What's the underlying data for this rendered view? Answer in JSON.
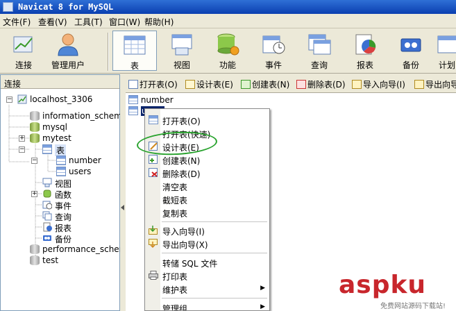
{
  "window": {
    "title": "Navicat 8 for MySQL"
  },
  "menu": [
    "文件(F)",
    "查看(V)",
    "工具(T)",
    "窗口(W)",
    "帮助(H)"
  ],
  "toolbar": [
    {
      "label": "连接",
      "icon": "connect-icon"
    },
    {
      "label": "管理用户",
      "icon": "user-icon"
    },
    {
      "label": "表",
      "icon": "table-icon",
      "selected": true
    },
    {
      "label": "视图",
      "icon": "view-icon"
    },
    {
      "label": "功能",
      "icon": "function-icon"
    },
    {
      "label": "事件",
      "icon": "event-icon"
    },
    {
      "label": "查询",
      "icon": "query-icon"
    },
    {
      "label": "报表",
      "icon": "report-icon"
    },
    {
      "label": "备份",
      "icon": "backup-icon"
    },
    {
      "label": "计划",
      "icon": "schedule-icon"
    }
  ],
  "left": {
    "header": "连接",
    "tree": [
      {
        "label": "localhost_3306"
      },
      {
        "label": "information_schema"
      },
      {
        "label": "mysql"
      },
      {
        "label": "mytest"
      },
      {
        "label": "表"
      },
      {
        "label": "number"
      },
      {
        "label": "users"
      },
      {
        "label": "视图"
      },
      {
        "label": "函数"
      },
      {
        "label": "事件"
      },
      {
        "label": "查询"
      },
      {
        "label": "报表"
      },
      {
        "label": "备份"
      },
      {
        "label": "performance_schema"
      },
      {
        "label": "test"
      }
    ]
  },
  "actions": [
    "打开表(O)",
    "设计表(E)",
    "创建表(N)",
    "删除表(D)",
    "导入向导(I)",
    "导出向导(X)"
  ],
  "items": [
    "number",
    "users"
  ],
  "context_menu": {
    "items": [
      "打开表(O)",
      "打开表(快速)",
      "设计表(E)",
      "创建表(N)",
      "删除表(D)",
      "清空表",
      "截短表",
      "复制表",
      "导入向导(I)",
      "导出向导(X)",
      "转储 SQL 文件",
      "打印表",
      "维护表",
      "管理组"
    ]
  },
  "watermark": {
    "logo": "aspku.com",
    "tagline": "免费网站源码下载站!"
  },
  "colors": {
    "title_bar": "#0a3fb0",
    "highlight_ellipse": "#29a32e",
    "watermark": "#c8262c"
  }
}
